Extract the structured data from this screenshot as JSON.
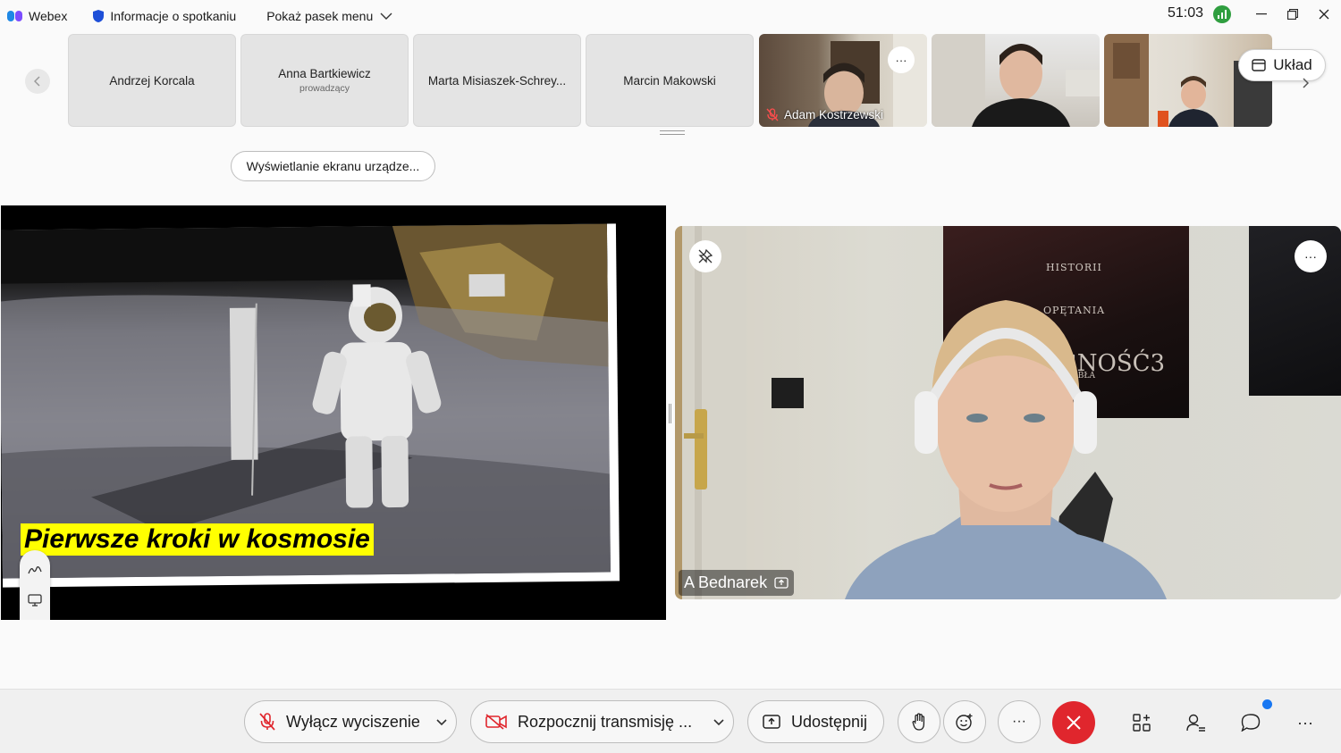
{
  "titlebar": {
    "app_name": "Webex",
    "meeting_info": "Informacje o spotkaniu",
    "show_menu": "Pokaż pasek menu",
    "timer": "51:03"
  },
  "participants": [
    {
      "name": "Andrzej Korcala",
      "role": ""
    },
    {
      "name": "Anna Bartkiewicz",
      "role": "prowadzący"
    },
    {
      "name": "Marta Misiaszek-Schrey...",
      "role": ""
    },
    {
      "name": "Marcin Makowski",
      "role": ""
    },
    {
      "name": "Adam Kostrzewski",
      "role": "",
      "video": true,
      "muted": true
    }
  ],
  "layout_button": "Układ",
  "share_view_button": "Wyświetlanie ekranu urządze...",
  "slide": {
    "caption": "Pierwsze kroki w kosmosie"
  },
  "speaker": {
    "name": "A Bednarek",
    "poster_lines": [
      "HISTORII",
      "OPĘTANIA",
      "EGNOŚĆ3",
      "ZKY DIABŁA"
    ]
  },
  "controls": {
    "mute_label": "Wyłącz wyciszenie",
    "video_label": "Rozpocznij transmisję ...",
    "share_label": "Udostępnij"
  },
  "colors": {
    "end_call": "#e0262d",
    "caption_bg": "#ffff00",
    "notification_dot": "#1877f2",
    "signal": "#2f9e3f"
  }
}
